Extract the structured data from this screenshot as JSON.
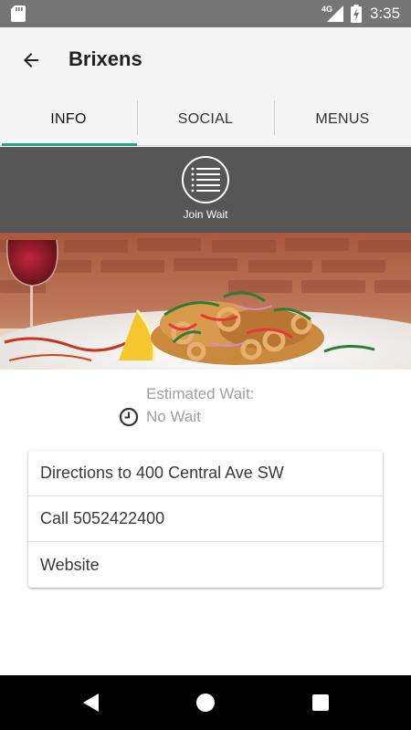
{
  "status_bar": {
    "network": "4G",
    "time": "3:35",
    "icons": [
      "sd-card-icon",
      "signal-icon",
      "battery-charging-icon"
    ]
  },
  "app_bar": {
    "title": "Brixens",
    "back_icon": "arrow-back-icon"
  },
  "tabs": [
    {
      "label": "INFO",
      "active": true
    },
    {
      "label": "SOCIAL",
      "active": false
    },
    {
      "label": "MENUS",
      "active": false
    }
  ],
  "join_wait": {
    "label": "Join Wait",
    "icon": "list-icon"
  },
  "wait_info": {
    "label": "Estimated Wait:",
    "value": "No Wait",
    "icon": "clock-icon"
  },
  "actions": [
    {
      "label": "Directions to 400 Central Ave SW"
    },
    {
      "label": "Call 5052422400"
    },
    {
      "label": "Website"
    }
  ],
  "nav_bar": {
    "icons": [
      "back-triangle-icon",
      "home-circle-icon",
      "recents-square-icon"
    ]
  },
  "colors": {
    "accent": "#1fa38a",
    "status_bar": "#757575",
    "join_band": "#565656"
  }
}
